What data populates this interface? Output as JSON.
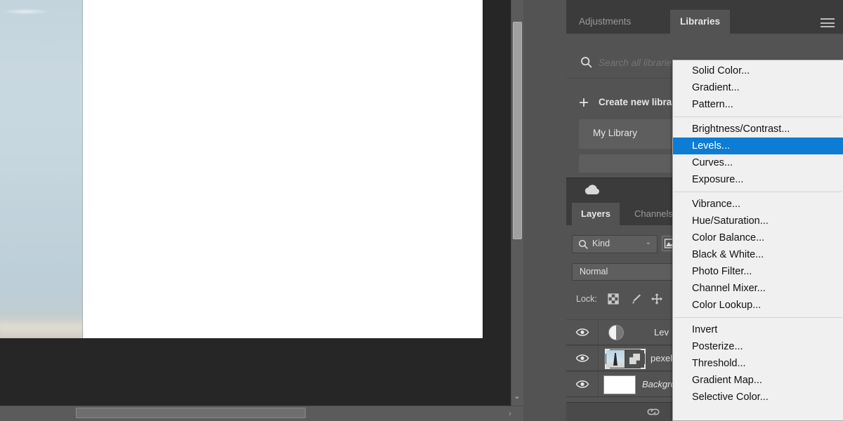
{
  "canvas": {
    "photo_alt": "beach-sky-photo-layer",
    "document_background": "#ffffff"
  },
  "scrollbars": {
    "vertical_arrow": "⌄",
    "horizontal_arrow": "›"
  },
  "libraries_panel": {
    "tabs": [
      {
        "label": "Adjustments",
        "active": false
      },
      {
        "label": "Libraries",
        "active": true
      }
    ],
    "panel_menu_icon": "hamburger-icon",
    "search": {
      "placeholder": "Search all libraries",
      "value": "",
      "icon": "search-icon"
    },
    "create_new": {
      "label": "Create new library",
      "icon": "plus-icon"
    },
    "items": [
      {
        "label": "My Library"
      },
      {
        "label": ""
      }
    ],
    "footer_icon": "cloud-icon"
  },
  "layers_panel": {
    "tabs": [
      {
        "label": "Layers",
        "active": true
      },
      {
        "label": "Channels",
        "active": false
      }
    ],
    "filter": {
      "kind_label": "Kind",
      "kind_icon": "search-icon",
      "caret": "⌄",
      "image_filter_icon": "image-filter-icon"
    },
    "blend_mode": "Normal",
    "lock": {
      "label": "Lock:",
      "icons": [
        "checkerboard-icon",
        "brush-icon",
        "move-icon",
        "artboard-icon"
      ]
    },
    "layers": [
      {
        "name": "Lev",
        "thumb": "levels-adjustment-icon",
        "visible": true,
        "italic": false
      },
      {
        "name": "pexels-",
        "thumb": "smart-object-thumbnail",
        "visible": true,
        "italic": false
      },
      {
        "name": "Backgro",
        "thumb": "white-thumbnail",
        "visible": true,
        "italic": true
      }
    ],
    "footer_icon": "link-icon"
  },
  "context_menu": {
    "highlight_color": "#0c7cd5",
    "groups": [
      {
        "items": [
          {
            "label": "Solid Color...",
            "selected": false
          },
          {
            "label": "Gradient...",
            "selected": false
          },
          {
            "label": "Pattern...",
            "selected": false
          }
        ]
      },
      {
        "items": [
          {
            "label": "Brightness/Contrast...",
            "selected": false
          },
          {
            "label": "Levels...",
            "selected": true
          },
          {
            "label": "Curves...",
            "selected": false
          },
          {
            "label": "Exposure...",
            "selected": false
          }
        ]
      },
      {
        "items": [
          {
            "label": "Vibrance...",
            "selected": false
          },
          {
            "label": "Hue/Saturation...",
            "selected": false
          },
          {
            "label": "Color Balance...",
            "selected": false
          },
          {
            "label": "Black & White...",
            "selected": false
          },
          {
            "label": "Photo Filter...",
            "selected": false
          },
          {
            "label": "Channel Mixer...",
            "selected": false
          },
          {
            "label": "Color Lookup...",
            "selected": false
          }
        ]
      },
      {
        "items": [
          {
            "label": "Invert",
            "selected": false
          },
          {
            "label": "Posterize...",
            "selected": false
          },
          {
            "label": "Threshold...",
            "selected": false
          },
          {
            "label": "Gradient Map...",
            "selected": false
          },
          {
            "label": "Selective Color...",
            "selected": false
          }
        ]
      }
    ]
  }
}
